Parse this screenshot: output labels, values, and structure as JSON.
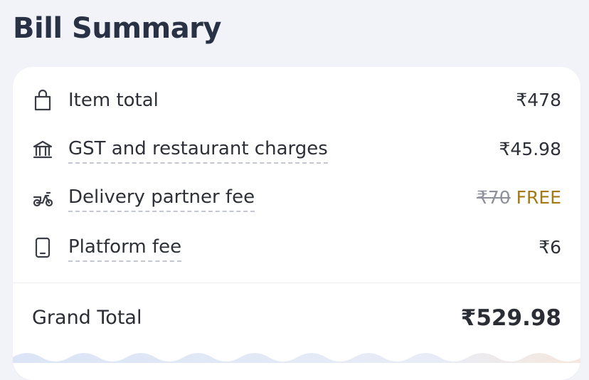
{
  "header": {
    "title": "Bill Summary"
  },
  "bill": {
    "items": [
      {
        "icon": "shopping-bag-icon",
        "label": "Item total",
        "value": "₹478"
      },
      {
        "icon": "bank-icon",
        "label": "GST and restaurant charges",
        "value": "₹45.98"
      },
      {
        "icon": "scooter-icon",
        "label": "Delivery partner fee",
        "original_value": "₹70",
        "value": "FREE"
      },
      {
        "icon": "phone-icon",
        "label": "Platform fee",
        "value": "₹6"
      }
    ],
    "grand_total_label": "Grand Total",
    "grand_total_value": "₹529.98"
  },
  "colors": {
    "background": "#f2f3f8",
    "card": "#ffffff",
    "free_text": "#a47a14",
    "strike_text": "#8e919a"
  }
}
